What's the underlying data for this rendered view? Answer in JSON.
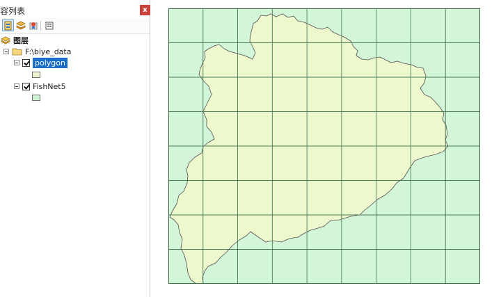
{
  "toc": {
    "title": "容列表",
    "close_glyph": "x",
    "toolbar": {
      "icons": [
        "list-by-drawing-order-icon",
        "list-by-source-icon",
        "list-by-visibility-icon",
        "options-icon"
      ]
    },
    "layers_group": "图层",
    "data_frame": "F:\\biye_data",
    "layers": [
      {
        "name": "polygon",
        "checked": true,
        "selected": true,
        "swatch_color": "#f0f4d4"
      },
      {
        "name": "FishNet5",
        "checked": true,
        "selected": false,
        "swatch_color": "#cdf2d2"
      }
    ]
  },
  "map": {
    "fishnet_fill": "#d3f5d8",
    "fishnet_line": "#4b7a57",
    "polygon_fill": "#eef8cd",
    "polygon_line": "#4e4e4e",
    "grid_rows": 8,
    "grid_cols": 9
  }
}
